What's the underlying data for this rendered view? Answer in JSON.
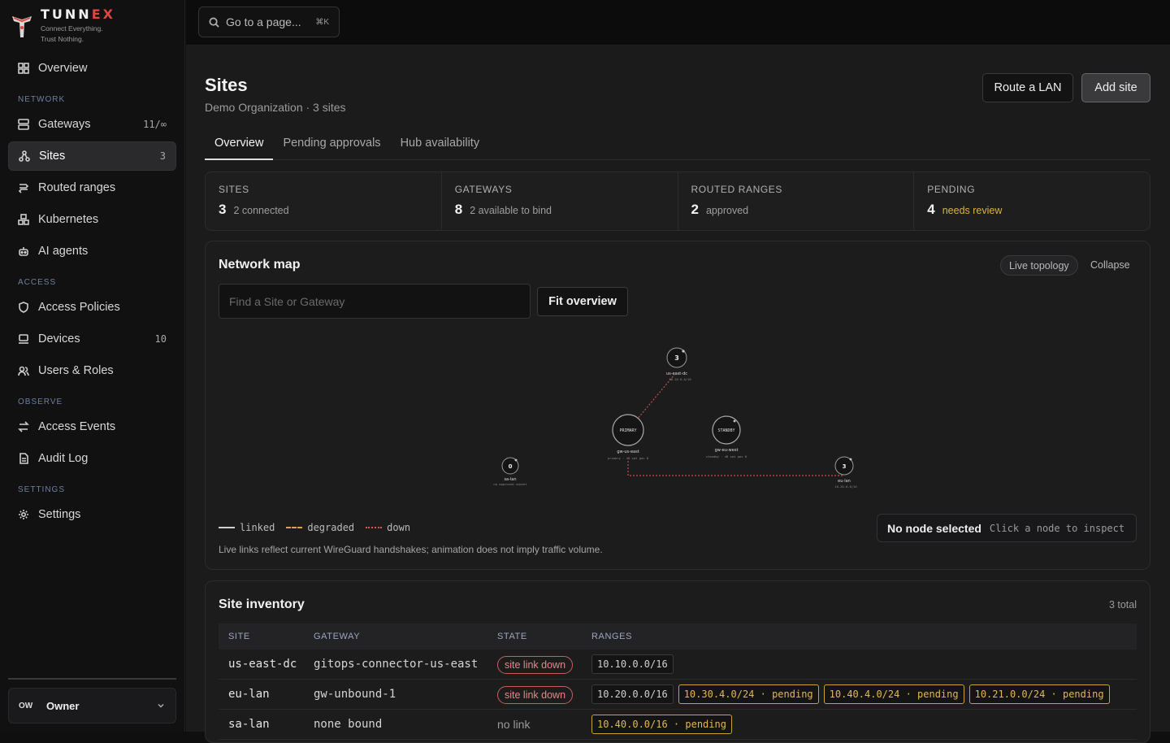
{
  "brand": {
    "name_a": "TUNN",
    "name_x": "EX",
    "tag1": "Connect Everything.",
    "tag2": "Trust Nothing."
  },
  "search": {
    "label": "Go to a page...",
    "kbd": "⌘K"
  },
  "sidebar": {
    "overview": "Overview",
    "section_network": "NETWORK",
    "gateways": "Gateways",
    "gateways_count": "11/∞",
    "sites": "Sites",
    "sites_count": "3",
    "routed": "Routed ranges",
    "kubernetes": "Kubernetes",
    "ai_agents": "AI agents",
    "section_access": "ACCESS",
    "access_policies": "Access Policies",
    "devices": "Devices",
    "devices_count": "10",
    "users_roles": "Users & Roles",
    "section_observe": "OBSERVE",
    "access_events": "Access Events",
    "audit_log": "Audit Log",
    "section_settings": "SETTINGS",
    "settings": "Settings",
    "owner_initials": "OW",
    "owner_name": "Owner"
  },
  "page": {
    "title": "Sites",
    "subtitle": "Demo Organization · 3 sites",
    "route_btn": "Route a LAN",
    "add_btn": "Add site",
    "tabs": [
      "Overview",
      "Pending approvals",
      "Hub availability"
    ]
  },
  "stats": [
    {
      "label": "SITES",
      "value": "3",
      "note": "2 connected"
    },
    {
      "label": "GATEWAYS",
      "value": "8",
      "note": "2 available to bind"
    },
    {
      "label": "ROUTED RANGES",
      "value": "2",
      "note": "approved"
    },
    {
      "label": "PENDING",
      "value": "4",
      "note": "needs review"
    }
  ],
  "map": {
    "title": "Network map",
    "chip": "Live topology",
    "collapse": "Collapse",
    "find_placeholder": "Find a Site or Gateway",
    "fit_btn": "Fit overview",
    "legend": [
      "linked",
      "degraded",
      "down"
    ],
    "note": "Live links reflect current WireGuard handshakes; animation does not imply traffic volume.",
    "inspect_title": "No node selected",
    "inspect_hint": "Click a node to inspect",
    "nodes": {
      "us_east_dc": {
        "count": "3",
        "name": "us-east-dc",
        "range": "10.10.0.0/16"
      },
      "primary": {
        "label": "PRIMARY",
        "name": "gw-us-east",
        "sub": "primary · 48 sat gov 8"
      },
      "standby": {
        "label": "STANDBY",
        "name": "gw-eu-west",
        "sub": "standby · 48 sat gov 8"
      },
      "sa_lan": {
        "count": "0",
        "name": "sa-lan",
        "sub": "no approved subnet"
      },
      "eu_lan": {
        "count": "3",
        "name": "eu-lan",
        "sub": "10.20.0.0/16"
      }
    }
  },
  "inventory": {
    "title": "Site inventory",
    "total": "3 total",
    "headers": [
      "SITE",
      "GATEWAY",
      "STATE",
      "RANGES"
    ],
    "rows": [
      {
        "site": "us-east-dc",
        "gateway": "gitops-connector-us-east",
        "state": "site link down",
        "ranges": [
          "10.10.0.0/16"
        ],
        "pending": []
      },
      {
        "site": "eu-lan",
        "gateway": "gw-unbound-1",
        "state": "site link down",
        "ranges": [
          "10.20.0.0/16"
        ],
        "pending": [
          "10.30.4.0/24 · pending",
          "10.40.4.0/24 · pending",
          "10.21.0.0/24 · pending"
        ]
      },
      {
        "site": "sa-lan",
        "gateway": "none bound",
        "state": "no link",
        "ranges": [],
        "pending": [
          "10.40.0.0/16 · pending"
        ]
      }
    ]
  }
}
